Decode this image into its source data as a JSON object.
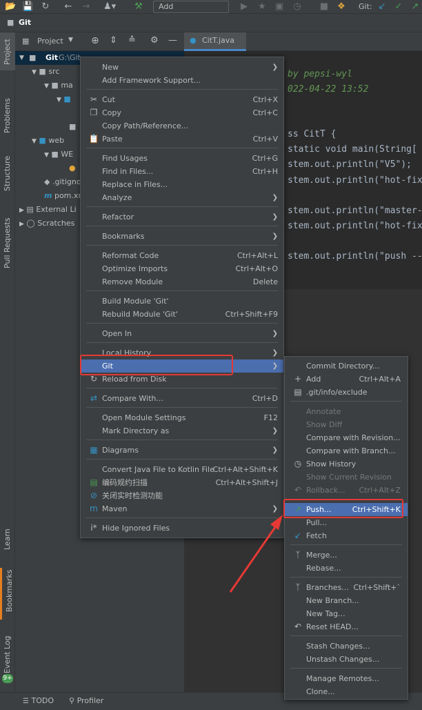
{
  "toolbar": {
    "add_configuration": "Add Configuration...",
    "git_label": "Git:",
    "icons": [
      "open-folder-icon",
      "save-icon",
      "sync-icon",
      "back-icon",
      "forward-icon",
      "user-icon",
      "build-hammer-icon",
      "run-icon",
      "debug-icon",
      "coverage-icon",
      "profile-icon",
      "stop-icon",
      "plugin-icon",
      "git-update-icon",
      "git-commit-icon",
      "git-push-icon"
    ]
  },
  "breadcrumb": {
    "project": "Git"
  },
  "left_tabs": {
    "project": "Project",
    "problems": "Problems",
    "structure": "Structure",
    "pull_requests": "Pull Requests",
    "learn": "Learn",
    "bookmarks": "Bookmarks",
    "event_log": "Event Log",
    "event_count": "9+"
  },
  "project_panel": {
    "title": "Project"
  },
  "tree": {
    "root": "Git",
    "root_path": "G:\\Git",
    "rows": [
      "src",
      "ma",
      "web",
      "WE",
      "m",
      ".gitigno",
      "pom.xm",
      "External Li",
      "Scratches"
    ]
  },
  "editor": {
    "tab": "CitT.java",
    "lines": [
      {
        "t": "by pepsi-wyl",
        "c": "cmt"
      },
      {
        "t": "022-04-22 13:52",
        "c": "cmt"
      },
      {
        "t": "ss CitT {",
        "c": "kw"
      },
      {
        "t": "static void main(String[",
        "c": "kw"
      },
      {
        "t": "stem.out.println(\"V5\");",
        "c": "code"
      },
      {
        "t": "stem.out.println(\"hot-fix",
        "c": "code"
      },
      {
        "t": "stem.out.println(\"master-",
        "c": "code"
      },
      {
        "t": "stem.out.println(\"hot-fix",
        "c": "code"
      },
      {
        "t": "stem.out.println(\"push --",
        "c": "code"
      }
    ]
  },
  "context_menu": {
    "items": [
      {
        "label": "New",
        "shortcut": "",
        "submenu": true
      },
      {
        "label": "Add Framework Support...",
        "shortcut": ""
      },
      {
        "label": "Cut",
        "shortcut": "Ctrl+X",
        "icon": "scissors-icon"
      },
      {
        "label": "Copy",
        "shortcut": "Ctrl+C",
        "icon": "copy-icon"
      },
      {
        "label": "Copy Path/Reference...",
        "shortcut": ""
      },
      {
        "label": "Paste",
        "shortcut": "Ctrl+V",
        "icon": "paste-icon"
      },
      {
        "label": "Find Usages",
        "shortcut": "Ctrl+G"
      },
      {
        "label": "Find in Files...",
        "shortcut": "Ctrl+H"
      },
      {
        "label": "Replace in Files...",
        "shortcut": ""
      },
      {
        "label": "Analyze",
        "shortcut": "",
        "submenu": true
      },
      {
        "label": "Refactor",
        "shortcut": "",
        "submenu": true
      },
      {
        "label": "Bookmarks",
        "shortcut": "",
        "submenu": true
      },
      {
        "label": "Reformat Code",
        "shortcut": "Ctrl+Alt+L"
      },
      {
        "label": "Optimize Imports",
        "shortcut": "Ctrl+Alt+O"
      },
      {
        "label": "Remove Module",
        "shortcut": "Delete"
      },
      {
        "label": "Build Module 'Git'",
        "shortcut": ""
      },
      {
        "label": "Rebuild Module 'Git'",
        "shortcut": "Ctrl+Shift+F9"
      },
      {
        "label": "Open In",
        "shortcut": "",
        "submenu": true
      },
      {
        "label": "Local History",
        "shortcut": "",
        "submenu": true
      },
      {
        "label": "Git",
        "shortcut": "",
        "submenu": true
      },
      {
        "label": "Reload from Disk",
        "shortcut": "",
        "icon": "reload-icon"
      },
      {
        "label": "Compare With...",
        "shortcut": "Ctrl+D",
        "icon": "compare-icon"
      },
      {
        "label": "Open Module Settings",
        "shortcut": "F12"
      },
      {
        "label": "Mark Directory as",
        "shortcut": "",
        "submenu": true
      },
      {
        "label": "Diagrams",
        "shortcut": "",
        "submenu": true,
        "icon": "diagram-icon"
      },
      {
        "label": "Convert Java File to Kotlin File",
        "shortcut": "Ctrl+Alt+Shift+K"
      },
      {
        "label": "编码规约扫描",
        "shortcut": "Ctrl+Alt+Shift+J",
        "icon": "scan-icon"
      },
      {
        "label": "关闭实时检测功能",
        "shortcut": "",
        "icon": "disable-icon"
      },
      {
        "label": "Maven",
        "shortcut": "",
        "submenu": true,
        "icon": "maven-icon"
      },
      {
        "label": "Hide Ignored Files",
        "shortcut": "",
        "icon": "ignored-icon"
      }
    ]
  },
  "git_submenu": {
    "items": [
      {
        "label": "Commit Directory...",
        "shortcut": ""
      },
      {
        "label": "Add",
        "shortcut": "Ctrl+Alt+A",
        "icon": "plus-icon"
      },
      {
        "label": ".git/info/exclude",
        "shortcut": "",
        "icon": "file-icon"
      },
      {
        "label": "Annotate",
        "shortcut": "",
        "disabled": true
      },
      {
        "label": "Show Diff",
        "shortcut": "",
        "disabled": true
      },
      {
        "label": "Compare with Revision...",
        "shortcut": ""
      },
      {
        "label": "Compare with Branch...",
        "shortcut": ""
      },
      {
        "label": "Show History",
        "shortcut": "",
        "icon": "clock-icon"
      },
      {
        "label": "Show Current Revision",
        "shortcut": "",
        "disabled": true
      },
      {
        "label": "Rollback...",
        "shortcut": "Ctrl+Alt+Z",
        "disabled": true,
        "icon": "rollback-icon"
      },
      {
        "label": "Push...",
        "shortcut": "Ctrl+Shift+K",
        "icon": "push-icon"
      },
      {
        "label": "Pull...",
        "shortcut": ""
      },
      {
        "label": "Fetch",
        "shortcut": "",
        "icon": "fetch-icon"
      },
      {
        "label": "Merge...",
        "shortcut": "",
        "icon": "merge-icon"
      },
      {
        "label": "Rebase...",
        "shortcut": ""
      },
      {
        "label": "Branches...",
        "shortcut": "Ctrl+Shift+`",
        "icon": "branch-icon"
      },
      {
        "label": "New Branch...",
        "shortcut": ""
      },
      {
        "label": "New Tag...",
        "shortcut": ""
      },
      {
        "label": "Reset HEAD...",
        "shortcut": "",
        "icon": "reset-icon"
      },
      {
        "label": "Stash Changes...",
        "shortcut": ""
      },
      {
        "label": "Unstash Changes...",
        "shortcut": ""
      },
      {
        "label": "Manage Remotes...",
        "shortcut": ""
      },
      {
        "label": "Clone...",
        "shortcut": ""
      }
    ]
  },
  "statusbar": {
    "todo": "TODO",
    "profiler": "Profiler"
  },
  "colors": {
    "highlight": "#4b6eaf",
    "annotation_red": "#e53935",
    "menu_bg": "#3c3f41"
  }
}
